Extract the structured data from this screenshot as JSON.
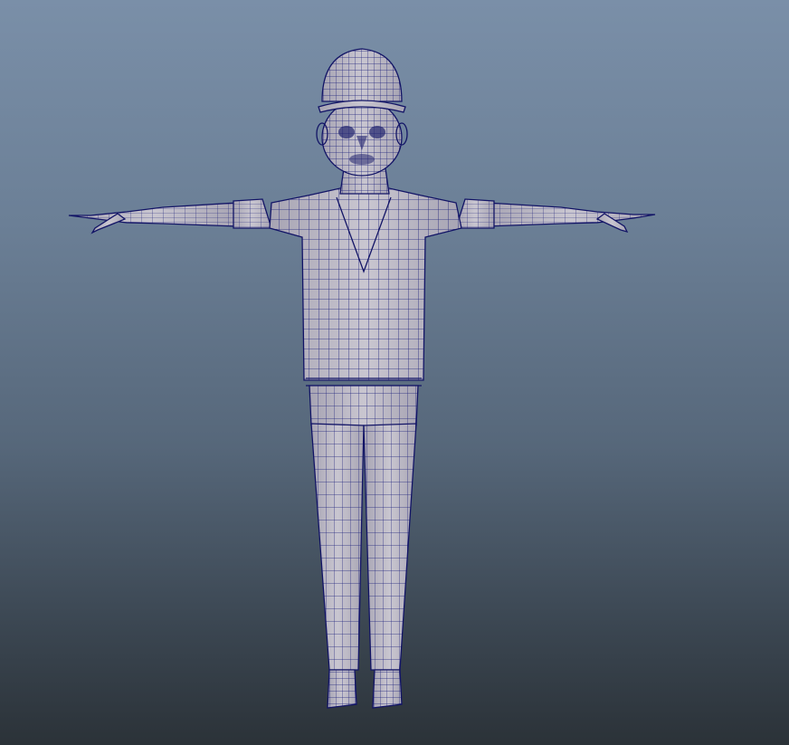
{
  "viewport": {
    "name": "3D viewport",
    "background_top": "#7a8fa8",
    "background_bottom": "#2b3238",
    "display_mode": "wireframe-on-shaded"
  },
  "model": {
    "subject": "stylized boy character",
    "pose": "T-pose",
    "view": "front",
    "surface_color": "#b9b6c2",
    "wire_color": "#1c1f7a",
    "parts": [
      "cap",
      "head",
      "neck",
      "torso",
      "left-arm",
      "right-arm",
      "left-hand",
      "right-hand",
      "pants",
      "left-leg",
      "right-leg",
      "left-shoe",
      "right-shoe"
    ]
  }
}
